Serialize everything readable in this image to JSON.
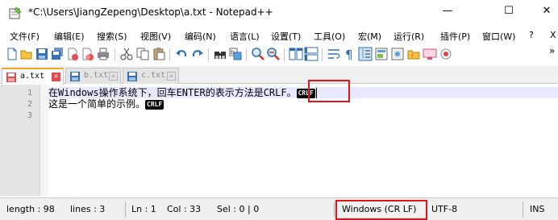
{
  "window": {
    "title": "*C:\\Users\\JiangZepeng\\Desktop\\a.txt - Notepad++",
    "minimize": "—",
    "maximize": "☐",
    "close": "✕"
  },
  "menu": [
    "文件(F)",
    "编辑(E)",
    "搜索(S)",
    "视图(V)",
    "编码(N)",
    "语言(L)",
    "设置(T)",
    "工具(O)",
    "宏(M)",
    "运行(R)",
    "插件(P)",
    "窗口(W)",
    "?",
    "X"
  ],
  "toolbar": {
    "icons": [
      "new-file-icon",
      "open-file-icon",
      "save-icon",
      "save-all-icon",
      "close-icon",
      "close-all-icon",
      "print-icon",
      "cut-icon",
      "copy-icon",
      "paste-icon",
      "undo-icon",
      "redo-icon",
      "find-icon",
      "replace-icon",
      "zoom-in-icon",
      "zoom-out-icon",
      "sync-vertical-icon",
      "sync-horizontal-icon",
      "word-wrap-icon",
      "show-all-chars-icon",
      "indent-guide-icon",
      "doc-map-icon",
      "function-list-icon",
      "folder-workspace-icon",
      "monitor-icon",
      "record-macro-icon"
    ],
    "overflow": "»"
  },
  "tabs": [
    {
      "label": "a.txt",
      "active": true
    },
    {
      "label": "b.txt",
      "active": false
    },
    {
      "label": "c.txt",
      "active": false
    }
  ],
  "editor": {
    "line_numbers": [
      "1",
      "2",
      "3"
    ],
    "lines": [
      {
        "text": "在Windows操作系统下，回车ENTER的表示方法是CRLF。",
        "eol": "CRLF"
      },
      {
        "text": "这是一个简单的示例。",
        "eol": "CRLF"
      },
      {
        "text": "",
        "eol": ""
      }
    ]
  },
  "status": {
    "length": "length : 98",
    "lines": "lines : 3",
    "ln": "Ln : 1",
    "col": "Col : 33",
    "sel": "Sel : 0 | 0",
    "eol_format": "Windows (CR LF)",
    "encoding": "UTF-8",
    "mode": "INS"
  },
  "colors": {
    "highlight_box": "#e0141b",
    "active_tab_accent": "#f5a623",
    "current_line": "#e8e8ff"
  }
}
